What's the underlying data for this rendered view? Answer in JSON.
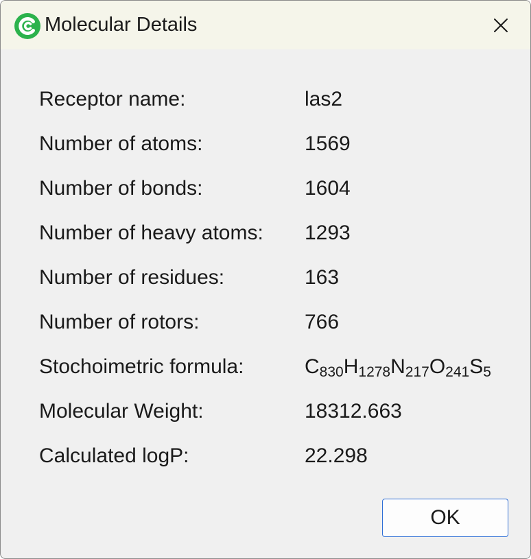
{
  "window": {
    "title": "Molecular Details",
    "app_icon": "green-c-logo-icon",
    "close_icon": "close-icon",
    "accent_color": "#2bb24c"
  },
  "details": [
    {
      "label": "Receptor name:",
      "value": "las2"
    },
    {
      "label": "Number of atoms:",
      "value": "1569"
    },
    {
      "label": "Number of bonds:",
      "value": "1604"
    },
    {
      "label": "Number of heavy atoms:",
      "value": "1293"
    },
    {
      "label": "Number of residues:",
      "value": "163"
    },
    {
      "label": "Number of rotors:",
      "value": "766"
    },
    {
      "label": "Stochoimetric formula:",
      "value": "",
      "formula": [
        {
          "element": "C",
          "count": "830"
        },
        {
          "element": "H",
          "count": "1278"
        },
        {
          "element": "N",
          "count": "217"
        },
        {
          "element": "O",
          "count": "241"
        },
        {
          "element": "S",
          "count": "5"
        }
      ]
    },
    {
      "label": "Molecular Weight:",
      "value": "18312.663"
    },
    {
      "label": "Calculated logP:",
      "value": "22.298"
    }
  ],
  "buttons": {
    "ok_label": "OK",
    "ok_border_color": "#2f6fd6"
  }
}
